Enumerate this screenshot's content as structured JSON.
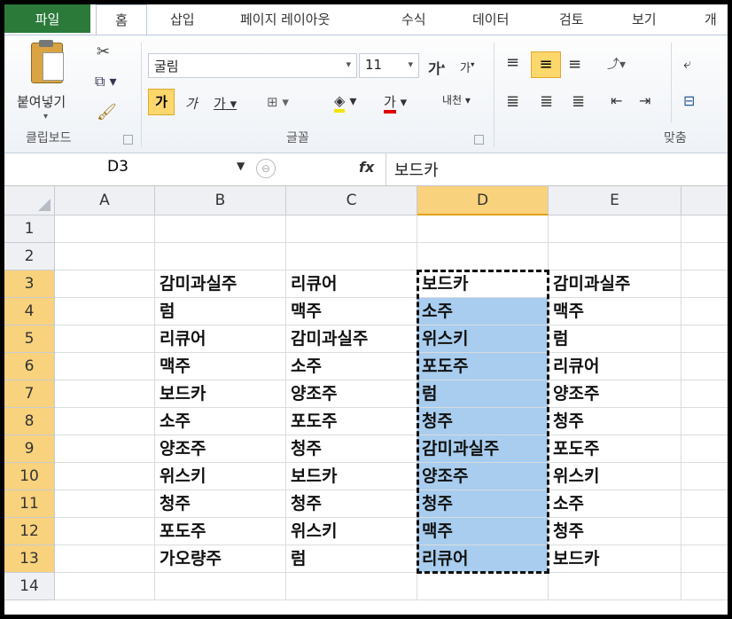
{
  "ribbon": {
    "tabs": [
      "파일",
      "홈",
      "삽입",
      "페이지 레이아웃",
      "수식",
      "데이터",
      "검토",
      "보기",
      "개"
    ],
    "clipboard": {
      "paste_label": "붙여넣기",
      "group_label": "클립보드"
    },
    "font": {
      "name": "굴림",
      "size": "11",
      "group_label": "글꼴",
      "bold_label": "가",
      "italic_label": "가",
      "underline_label": "가",
      "color_label": "가",
      "phonetic_label": "내천"
    },
    "alignment": {
      "group_label": "맞춤"
    }
  },
  "formula_bar": {
    "name_box": "D3",
    "fx_label": "fx",
    "value": "보드카"
  },
  "grid": {
    "columns": [
      "A",
      "B",
      "C",
      "D",
      "E"
    ],
    "rows": [
      "1",
      "2",
      "3",
      "4",
      "5",
      "6",
      "7",
      "8",
      "9",
      "10",
      "11",
      "12",
      "13",
      "14"
    ],
    "selected_column": "D",
    "data": {
      "B": [
        "",
        "",
        "감미과실주",
        "럼",
        "리큐어",
        "맥주",
        "보드카",
        "소주",
        "양조주",
        "위스키",
        "청주",
        "포도주",
        "가오량주",
        ""
      ],
      "C": [
        "",
        "",
        "리큐어",
        "맥주",
        "감미과실주",
        "소주",
        "양조주",
        "포도주",
        "청주",
        "보드카",
        "청주",
        "위스키",
        "럼",
        ""
      ],
      "D": [
        "",
        "",
        "보드카",
        "소주",
        "위스키",
        "포도주",
        "럼",
        "청주",
        "감미과실주",
        "양조주",
        "청주",
        "맥주",
        "리큐어",
        ""
      ],
      "E": [
        "",
        "",
        "감미과실주",
        "맥주",
        "럼",
        "리큐어",
        "양조주",
        "청주",
        "포도주",
        "위스키",
        "소주",
        "청주",
        "보드카",
        ""
      ]
    }
  }
}
